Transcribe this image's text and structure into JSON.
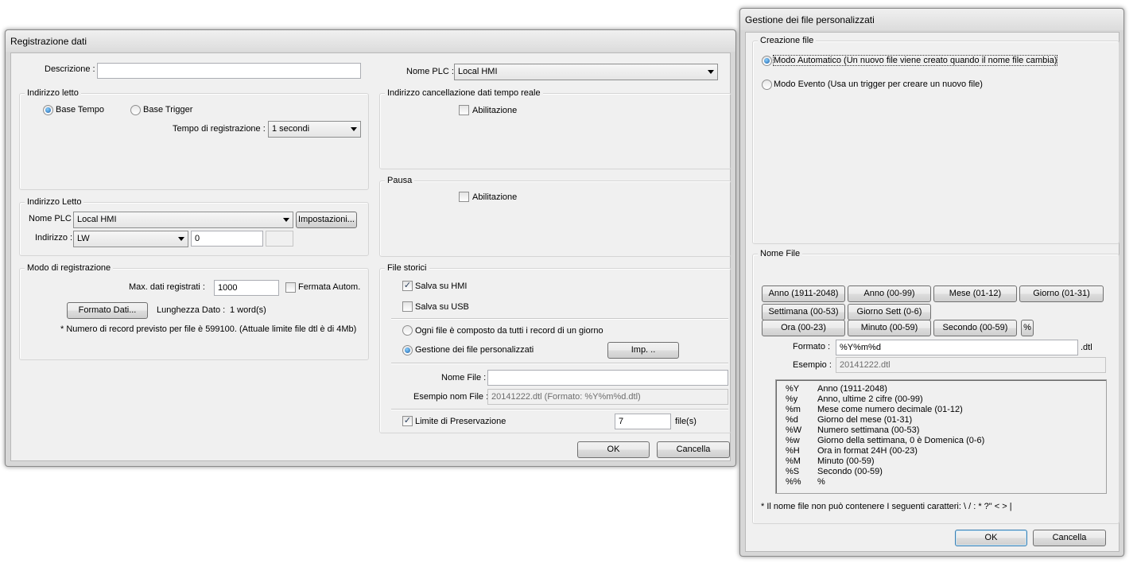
{
  "registrazione": {
    "title": "Registrazione dati",
    "descrizione_label": "Descrizione :",
    "descrizione_value": "",
    "nome_plc_label": "Nome PLC :",
    "nome_plc_value": "Local HMI",
    "indirizzo_letto": {
      "group_label": "Indirizzo letto",
      "base_tempo": "Base Tempo",
      "base_trigger": "Base Trigger",
      "selected": "Base Tempo",
      "tempo_label": "Tempo di registrazione :",
      "tempo_value": "1 secondi"
    },
    "cancellazione": {
      "group_label": "Indirizzo cancellazione dati tempo reale",
      "abilitazione": "Abilitazione",
      "checked": false
    },
    "pausa": {
      "group_label": "Pausa",
      "abilitazione": "Abilitazione",
      "checked": false
    },
    "indirizzo_letto2": {
      "group_label": "Indirizzo Letto",
      "nome_plc_label": "Nome PLC :",
      "nome_plc_value": "Local HMI",
      "impostazioni_button": "Impostazioni...",
      "indirizzo_label": "Indirizzo :",
      "indirizzo_type": "LW",
      "indirizzo_value": "0",
      "indirizzo_extra": ""
    },
    "modo": {
      "group_label": "Modo di registrazione",
      "max_label": "Max. dati registrati :",
      "max_value": "1000",
      "fermata_label": "Fermata Autom.",
      "fermata_checked": false,
      "formato_button": "Formato Dati...",
      "lunghezza_label": "Lunghezza Dato :",
      "lunghezza_value": "1 word(s)",
      "note": "* Numero di record previsto per file è 599100. (Attuale limite file dtl è di 4Mb)"
    },
    "file_storici": {
      "group_label": "File storici",
      "salva_hmi": "Salva su HMI",
      "salva_hmi_checked": true,
      "salva_usb": "Salva su USB",
      "salva_usb_checked": false,
      "ogni_file": "Ogni file è composto da tutti i record di un giorno",
      "gestione": "Gestione dei file personalizzati",
      "selected": "Gestione dei file personalizzati",
      "imp_button": "Imp. ..",
      "nome_file_label": "Nome File :",
      "nome_file_value": "",
      "esempio_label": "Esempio nom File :",
      "esempio_value": "20141222.dtl (Formato: %Y%m%d.dtl)",
      "limite_label": "Limite di Preservazione",
      "limite_checked": true,
      "limite_value": "7",
      "limite_unit": "file(s)"
    },
    "ok_button": "OK",
    "cancel_button": "Cancella"
  },
  "gestione": {
    "title": "Gestione dei file personalizzati",
    "creazione": {
      "group_label": "Creazione file",
      "modo_automatico": "Modo Automatico (Un nuovo file viene creato quando il nome file cambia)",
      "modo_evento": "Modo Evento (Usa un trigger per creare un nuovo file)",
      "selected": "Modo Automatico"
    },
    "nome_file": {
      "group_label": "Nome File",
      "buttons_row1": [
        "Anno (1911-2048)",
        "Anno (00-99)",
        "Mese (01-12)",
        "Giorno (01-31)"
      ],
      "buttons_row2": [
        "Settimana (00-53)",
        "Giorno Sett (0-6)"
      ],
      "buttons_row3": [
        "Ora (00-23)",
        "Minuto (00-59)",
        "Secondo (00-59)",
        "%"
      ],
      "formato_label": "Formato :",
      "formato_value": "%Y%m%d",
      "formato_ext": ".dtl",
      "esempio_label": "Esempio :",
      "esempio_value": "20141222.dtl",
      "legend": [
        {
          "code": "%Y",
          "desc": "Anno (1911-2048)"
        },
        {
          "code": "%y",
          "desc": "Anno, ultime 2 cifre (00-99)"
        },
        {
          "code": "%m",
          "desc": "Mese come numero decimale (01-12)"
        },
        {
          "code": "%d",
          "desc": "Giorno del mese (01-31)"
        },
        {
          "code": "%W",
          "desc": "Numero settimana (00-53)"
        },
        {
          "code": "%w",
          "desc": "Giorno della settimana, 0 è Domenica (0-6)"
        },
        {
          "code": "%H",
          "desc": "Ora in format 24H (00-23)"
        },
        {
          "code": "%M",
          "desc": "Minuto (00-59)"
        },
        {
          "code": "%S",
          "desc": "Secondo (00-59)"
        },
        {
          "code": "%%",
          "desc": "%"
        }
      ],
      "note": "* Il nome file non può contenere I seguenti caratteri: \\ / : * ?\" < > |"
    },
    "ok_button": "OK",
    "cancel_button": "Cancella"
  }
}
